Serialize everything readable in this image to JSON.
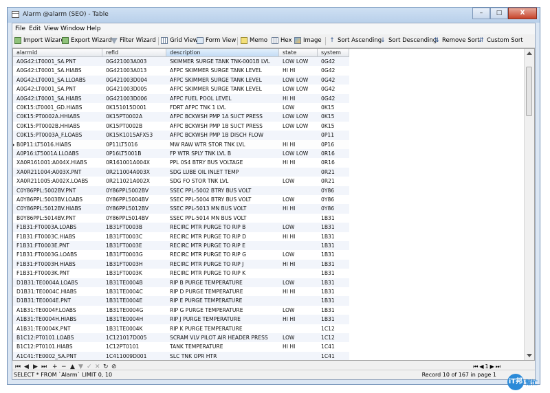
{
  "window": {
    "title": "Alarm @alarm (SEO) - Table",
    "controls": [
      "–",
      "□",
      "X"
    ]
  },
  "menu": [
    "File",
    "Edit",
    "View",
    "Window",
    "Help"
  ],
  "toolbar": {
    "import_wizard": "Import Wizard",
    "export_wizard": "Export Wizard",
    "filter_wizard": "Filter Wizard",
    "grid_view": "Grid View",
    "form_view": "Form View",
    "memo": "Memo",
    "hex": "Hex",
    "image": "Image",
    "sort_ascending": "Sort Ascending",
    "sort_descending": "Sort Descending",
    "remove_sort": "Remove Sort",
    "custom_sort": "Custom Sort"
  },
  "table": {
    "columns": [
      "alarmid",
      "refid",
      "description",
      "state",
      "system"
    ],
    "active_column": "description",
    "selected_row": 9,
    "rows": [
      [
        "A0G42:LT0001_SA.PNT",
        "0G421003A003",
        "SKIMMER SURGE TANK TNK-0001B LVL",
        "LOW LOW",
        "0G42"
      ],
      [
        "A0G42:LT0001_SA.HIABS",
        "0G421003A013",
        "AFPC SKIMMER SURGE TANK LEVEL",
        "HI HI",
        "0G42"
      ],
      [
        "A0G42:LT0001_SA.LLOABS",
        "0G421003D004",
        "AFPC SKIMMER SURGE TANK LEVEL",
        "LOW LOW",
        "0G42"
      ],
      [
        "A0G42:LT0001_SA.PNT",
        "0G421003D005",
        "AFPC SKIMMER SURGE TANK LEVEL",
        "LOW LOW",
        "0G42"
      ],
      [
        "A0G42:LT0001_SA.HIABS",
        "0G421003D006",
        "AFPC FUEL POOL LEVEL",
        "HI HI",
        "0G42"
      ],
      [
        "C0K15:LT0001_GD.HIABS",
        "0K151015D001",
        "FDRT AFPC TNK 1 LVL",
        "LOW",
        "0K15"
      ],
      [
        "C0K15:PT0002A.HHIABS",
        "0K15PT0002A",
        "AFPC BCKWSH PMP 1A SUCT PRESS",
        "LOW LOW",
        "0K15"
      ],
      [
        "C0K15:PT0002B.HHIABS",
        "0K15PT0002B",
        "AFPC BCKWSH PMP 1B SUCT PRESS",
        "LOW LOW",
        "0K15"
      ],
      [
        "C0K15:PT0003A_F.LOABS",
        "0K15K1015AFX53",
        "AFPC BCKWSH PMP 1B DISCH FLOW",
        "",
        "0P11"
      ],
      [
        "B0P11:LT5016.HIABS",
        "0P11LT5016",
        "MW RAW WTR STOR TNK LVL",
        "HI HI",
        "0P16"
      ],
      [
        "A0P16:LT5001A.LLOABS",
        "0P16LT5001B",
        "FP WTR SPLY TNK LVL B",
        "LOW LOW",
        "0R16"
      ],
      [
        "XA0R161001:A004X.HIABS",
        "0R161001A004X",
        "PPL 0S4 BTRY BUS VOLTAGE",
        "HI HI",
        "0R16"
      ],
      [
        "XA0R211004:A003X.PNT",
        "0R211004A003X",
        "SDG LUBE OIL INLET TEMP",
        "",
        "0R21"
      ],
      [
        "XA0R211005:A002X.LOABS",
        "0R211021A002X",
        "SDG FO STOR TNK LVL",
        "LOW",
        "0R21"
      ],
      [
        "C0Y86PPL:5002BV.PNT",
        "0Y86PPL5002BV",
        "SSEC PPL-5002 BTRY BUS VOLT",
        "",
        "0Y86"
      ],
      [
        "A0Y86PPL:5003BV.LOABS",
        "0Y86PPL5004BV",
        "SSEC PPL-5004 BTRY BUS VOLT",
        "LOW",
        "0Y86"
      ],
      [
        "C0Y86PPL:5012BV.HIABS",
        "0Y86PPL5012BV",
        "SSEC PPL-5013 MN BUS VOLT",
        "HI HI",
        "0Y86"
      ],
      [
        "B0Y86PPL:5014BV.PNT",
        "0Y86PPL5014BV",
        "SSEC PPL-5014 MN BUS VOLT",
        "",
        "1B31"
      ],
      [
        "F1B31:FT0003A.LOABS",
        "1B31FT0003B",
        "RECIRC MTR PURGE TO RIP B",
        "LOW",
        "1B31"
      ],
      [
        "F1B31:FT0003C.HIABS",
        "1B31FT0003C",
        "RECIRC MTR PURGE TO RIP D",
        "HI HI",
        "1B31"
      ],
      [
        "F1B31:FT0003E.PNT",
        "1B31FT0003E",
        "RECIRC MTR PURGE TO RIP E",
        "",
        "1B31"
      ],
      [
        "F1B31:FT0003G.LOABS",
        "1B31FT0003G",
        "RECIRC MTR PURGE TO RIP G",
        "LOW",
        "1B31"
      ],
      [
        "F1B31:FT0003H.HIABS",
        "1B31FT0003H",
        "RECIRC MTR PURGE TO RIP J",
        "HI HI",
        "1B31"
      ],
      [
        "F1B31:FT0003K.PNT",
        "1B31FT0003K",
        "RECIRC MTR PURGE TO RIP K",
        "",
        "1B31"
      ],
      [
        "D1B31:TE0004A.LOABS",
        "1B31TE0004B",
        "RIP B PURGE TEMPERATURE",
        "LOW",
        "1B31"
      ],
      [
        "D1B31:TE0004C.HIABS",
        "1B31TE0004C",
        "RIP D PURGE TEMPERATURE",
        "HI HI",
        "1B31"
      ],
      [
        "D1B31:TE0004E.PNT",
        "1B31TE0004E",
        "RIP E PURGE TEMPERATURE",
        "",
        "1B31"
      ],
      [
        "A1B31:TE0004F.LOABS",
        "1B31TE0004G",
        "RIP G PURGE TEMPERATURE",
        "LOW",
        "1B31"
      ],
      [
        "A1B31:TE0004H.HIABS",
        "1B31TE0004H",
        "RIP J PURGE TEMPERATURE",
        "HI HI",
        "1B31"
      ],
      [
        "A1B31:TE0004K.PNT",
        "1B31TE0004K",
        "RIP K PURGE TEMPERATURE",
        "",
        "1C12"
      ],
      [
        "B1C12:PT0101.LOABS",
        "1C121017D005",
        "SCRAM VLV PILOT AIR HEADER PRESS",
        "LOW",
        "1C12"
      ],
      [
        "B1C12:PT0101.HIABS",
        "1C12PT0101",
        "TANK TEMPERATURE",
        "HI HI",
        "1C41"
      ],
      [
        "A1C41:TE0002_SA.PNT",
        "1C411009D001",
        "SLC TNK OPR HTR",
        "",
        "1C41"
      ]
    ]
  },
  "navigator": {
    "first": "⏮",
    "prev": "◀",
    "next": "▶",
    "last": "⏭",
    "add": "+",
    "delete": "−",
    "up": "▲",
    "down": "▼",
    "apply": "✓",
    "cancel": "✕",
    "refresh": "↻",
    "stop": "⊘"
  },
  "status": {
    "query": "SELECT * FROM `Alarm` LIMIT 0, 10",
    "record": "Record 10 of 167 in page 1",
    "page": "1"
  },
  "watermark": {
    "mark": "iT邦",
    "text": "幫忙"
  }
}
